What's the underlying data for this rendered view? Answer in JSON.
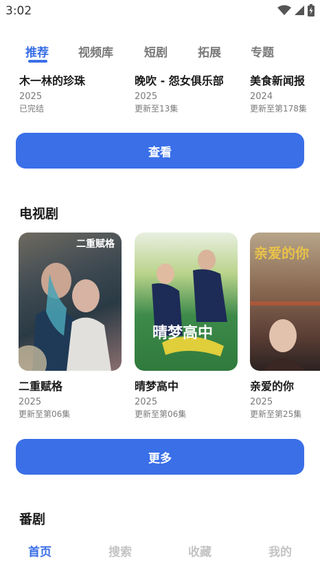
{
  "status_bar": {
    "time": "3:02"
  },
  "top_tabs": [
    {
      "label": "推荐",
      "active": true
    },
    {
      "label": "视频库",
      "active": false
    },
    {
      "label": "短剧",
      "active": false
    },
    {
      "label": "拓展",
      "active": false
    },
    {
      "label": "专题",
      "active": false
    }
  ],
  "recommend_row": [
    {
      "title": "木一林的珍珠",
      "year": "2025",
      "status": "已完结"
    },
    {
      "title": "晚吹 - 怨女俱乐部",
      "year": "2025",
      "status": "更新至13集"
    },
    {
      "title": "美食新闻报",
      "year": "2024",
      "status": "更新至第178集"
    }
  ],
  "view_button": "查看",
  "tv_section": {
    "title": "电视剧",
    "items": [
      {
        "title": "二重赋格",
        "year": "2025",
        "status": "更新至第06集",
        "poster_text": "二重赋格"
      },
      {
        "title": "晴梦高中",
        "year": "2025",
        "status": "更新至第06集",
        "poster_text": "晴梦高中"
      },
      {
        "title": "亲爱的你",
        "year": "2025",
        "status": "更新至第25集",
        "poster_text": "亲爱的你"
      }
    ]
  },
  "more_button": "更多",
  "next_section_title": "番剧",
  "bottom_nav": [
    {
      "label": "首页",
      "active": true
    },
    {
      "label": "搜索",
      "active": false
    },
    {
      "label": "收藏",
      "active": false
    },
    {
      "label": "我的",
      "active": false
    }
  ],
  "colors": {
    "accent": "#3a6fe8",
    "muted": "#7a7a7a",
    "nav_inactive": "#c4c4c4"
  }
}
